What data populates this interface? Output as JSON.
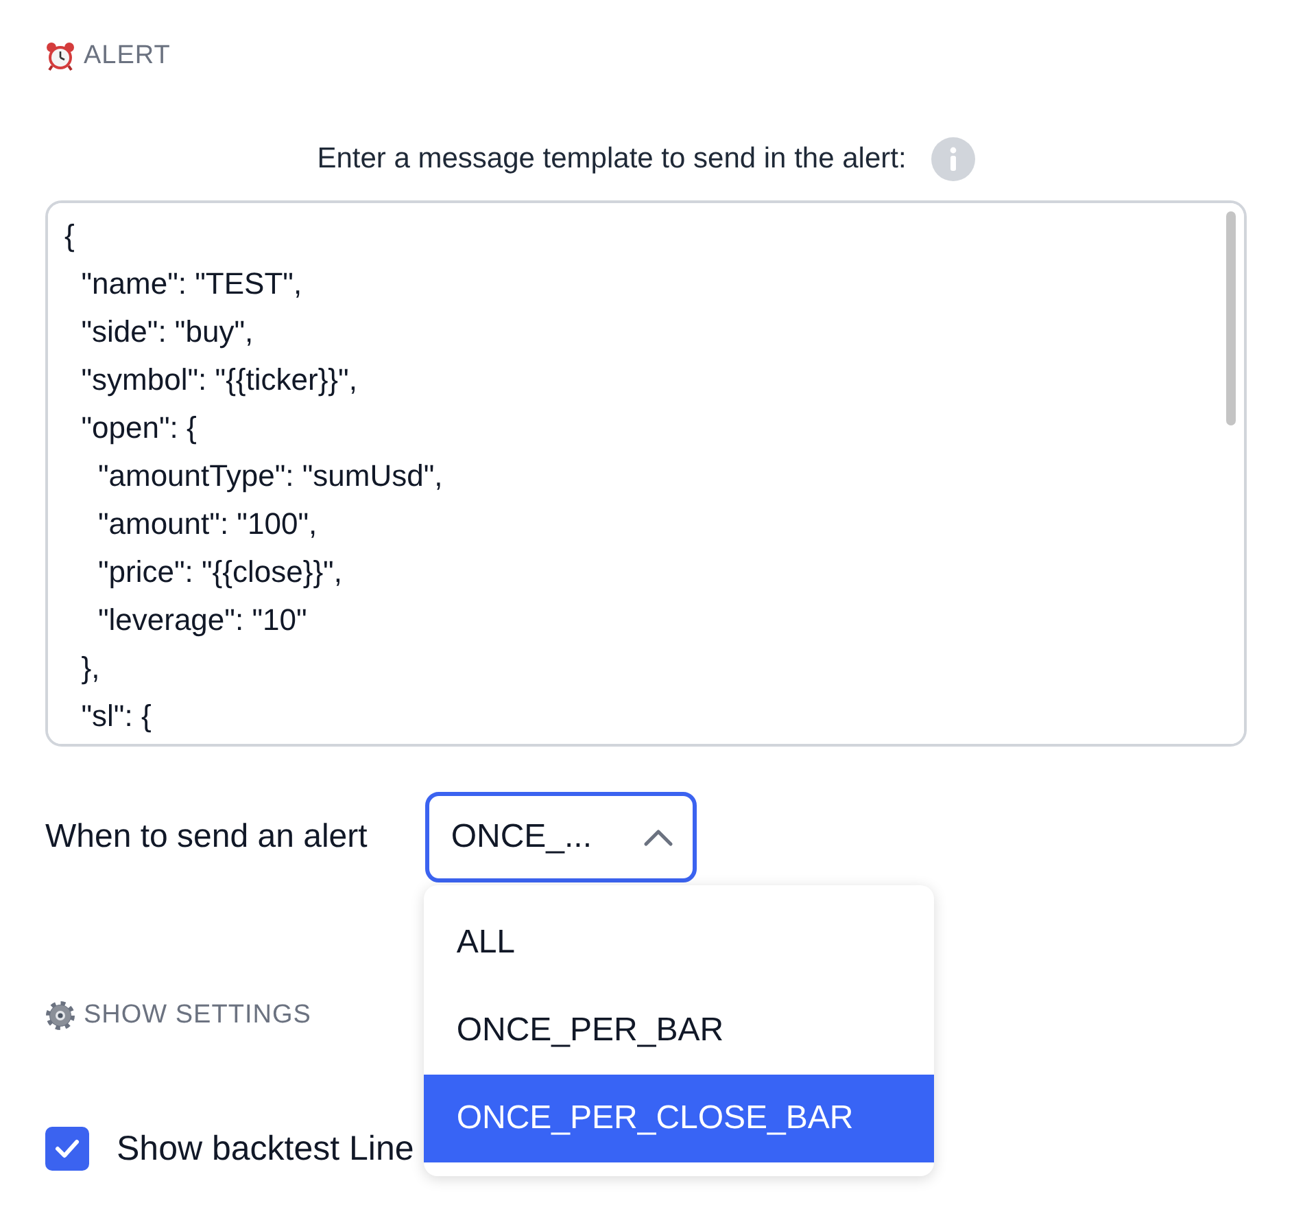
{
  "alert_section": {
    "title": "ALERT"
  },
  "message_template": {
    "label": "Enter a message template to send in the alert:",
    "value": "{\n  \"name\": \"TEST\",\n  \"side\": \"buy\",\n  \"symbol\": \"{{ticker}}\",\n  \"open\": {\n    \"amountType\": \"sumUsd\",\n    \"amount\": \"100\",\n    \"price\": \"{{close}}\",\n    \"leverage\": \"10\"\n  },\n  \"sl\": {"
  },
  "send_when": {
    "label": "When to send an alert",
    "value": "ONCE_...",
    "expanded": true,
    "options": [
      {
        "label": "ALL",
        "selected": false
      },
      {
        "label": "ONCE_PER_BAR",
        "selected": false
      },
      {
        "label": "ONCE_PER_CLOSE_BAR",
        "selected": true
      }
    ]
  },
  "settings_toggle": {
    "label": "SHOW SETTINGS"
  },
  "show_backtest_line": {
    "label": "Show backtest Line",
    "checked": true
  }
}
